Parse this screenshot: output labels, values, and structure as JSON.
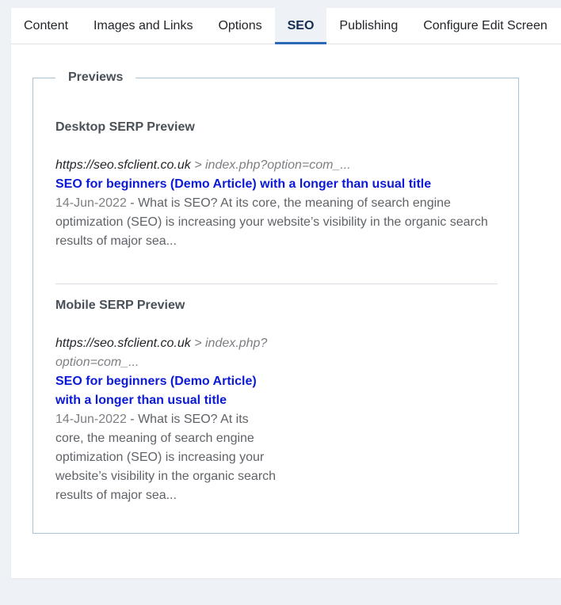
{
  "tabs": [
    {
      "label": "Content"
    },
    {
      "label": "Images and Links"
    },
    {
      "label": "Options"
    },
    {
      "label": "SEO"
    },
    {
      "label": "Publishing"
    },
    {
      "label": "Configure Edit Screen"
    }
  ],
  "active_tab": "SEO",
  "previews": {
    "legend": "Previews",
    "desktop": {
      "heading": "Desktop SERP Preview",
      "url_domain": "https://seo.sfclient.co.uk",
      "url_path": " > index.php?option=com_...",
      "title": "SEO for beginners (Demo Article) with a longer than usual title",
      "date": "14-Jun-2022",
      "description": " - What is SEO? At its core, the meaning of search engine optimization (SEO) is increasing your website’s visibility in the organic search results of major sea..."
    },
    "mobile": {
      "heading": "Mobile SERP Preview",
      "url_domain": "https://seo.sfclient.co.uk",
      "url_path": " > index.php?option=com_...",
      "title": "SEO for beginners (Demo Article) with a longer than usual title",
      "date": "14-Jun-2022",
      "description": " - What is SEO? At its core, the meaning of search engine optimization (SEO) is increasing your website’s visibility in the organic search results of major sea..."
    }
  },
  "colors": {
    "link_title": "#0b1ad6",
    "active_tab_underline": "#2a69b8",
    "fieldset_border": "#a9c4d6"
  }
}
